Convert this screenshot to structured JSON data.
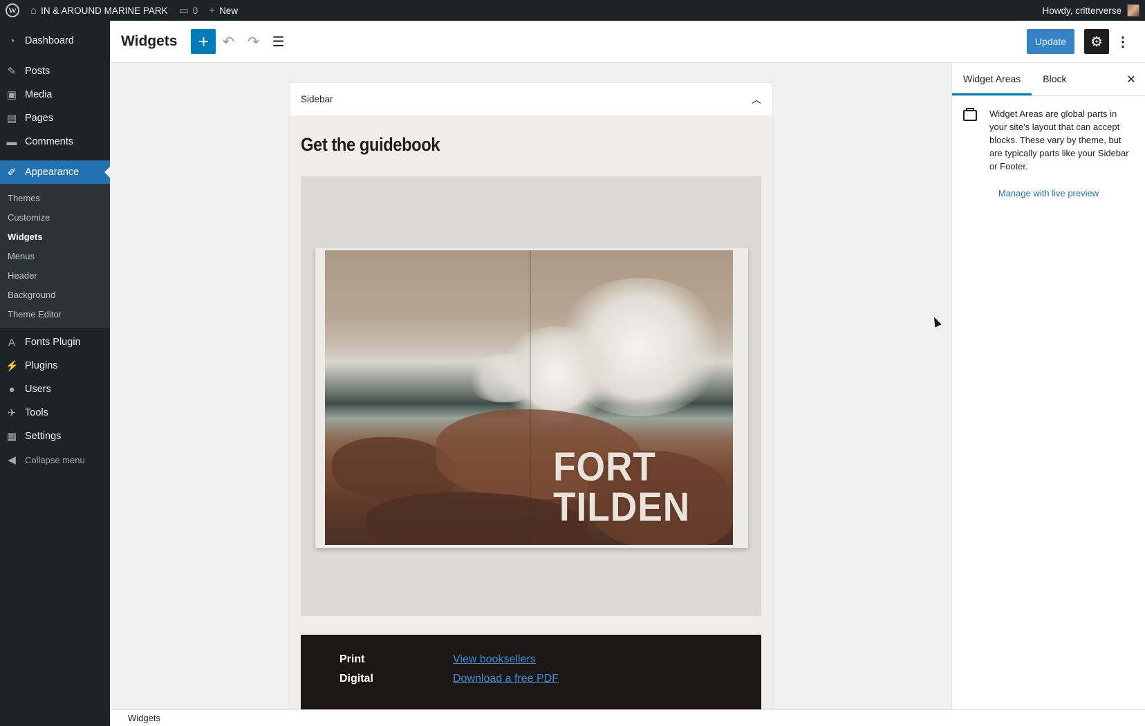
{
  "admin_bar": {
    "site_name": "IN & AROUND MARINE PARK",
    "comments_count": "0",
    "new_label": "New",
    "greeting": "Howdy, critterverse"
  },
  "menu": {
    "dashboard": "Dashboard",
    "posts": "Posts",
    "media": "Media",
    "pages": "Pages",
    "comments": "Comments",
    "appearance": "Appearance",
    "submenu": [
      "Themes",
      "Customize",
      "Widgets",
      "Menus",
      "Header",
      "Background",
      "Theme Editor"
    ],
    "fonts_plugin": "Fonts Plugin",
    "plugins": "Plugins",
    "users": "Users",
    "tools": "Tools",
    "settings": "Settings",
    "collapse": "Collapse menu"
  },
  "header": {
    "title": "Widgets",
    "update_label": "Update"
  },
  "widget_area": {
    "name": "Sidebar",
    "heading": "Get the guidebook",
    "book_title_line1": "FORT",
    "book_title_line2": "TILDEN",
    "rows": [
      {
        "label": "Print",
        "link": "View booksellers"
      },
      {
        "label": "Digital",
        "link": "Download a free PDF"
      }
    ]
  },
  "panel": {
    "tab_widget_areas": "Widget Areas",
    "tab_block": "Block",
    "description": "Widget Areas are global parts in your site's layout that can accept blocks. These vary by theme, but are typically parts like your Sidebar or Footer.",
    "live_preview_link": "Manage with live preview"
  },
  "footer": {
    "breadcrumb": "Widgets"
  },
  "colors": {
    "admin_dark": "#1d2327",
    "accent": "#2271b1",
    "inserter": "#007cba",
    "update_button": "#3582c4"
  }
}
